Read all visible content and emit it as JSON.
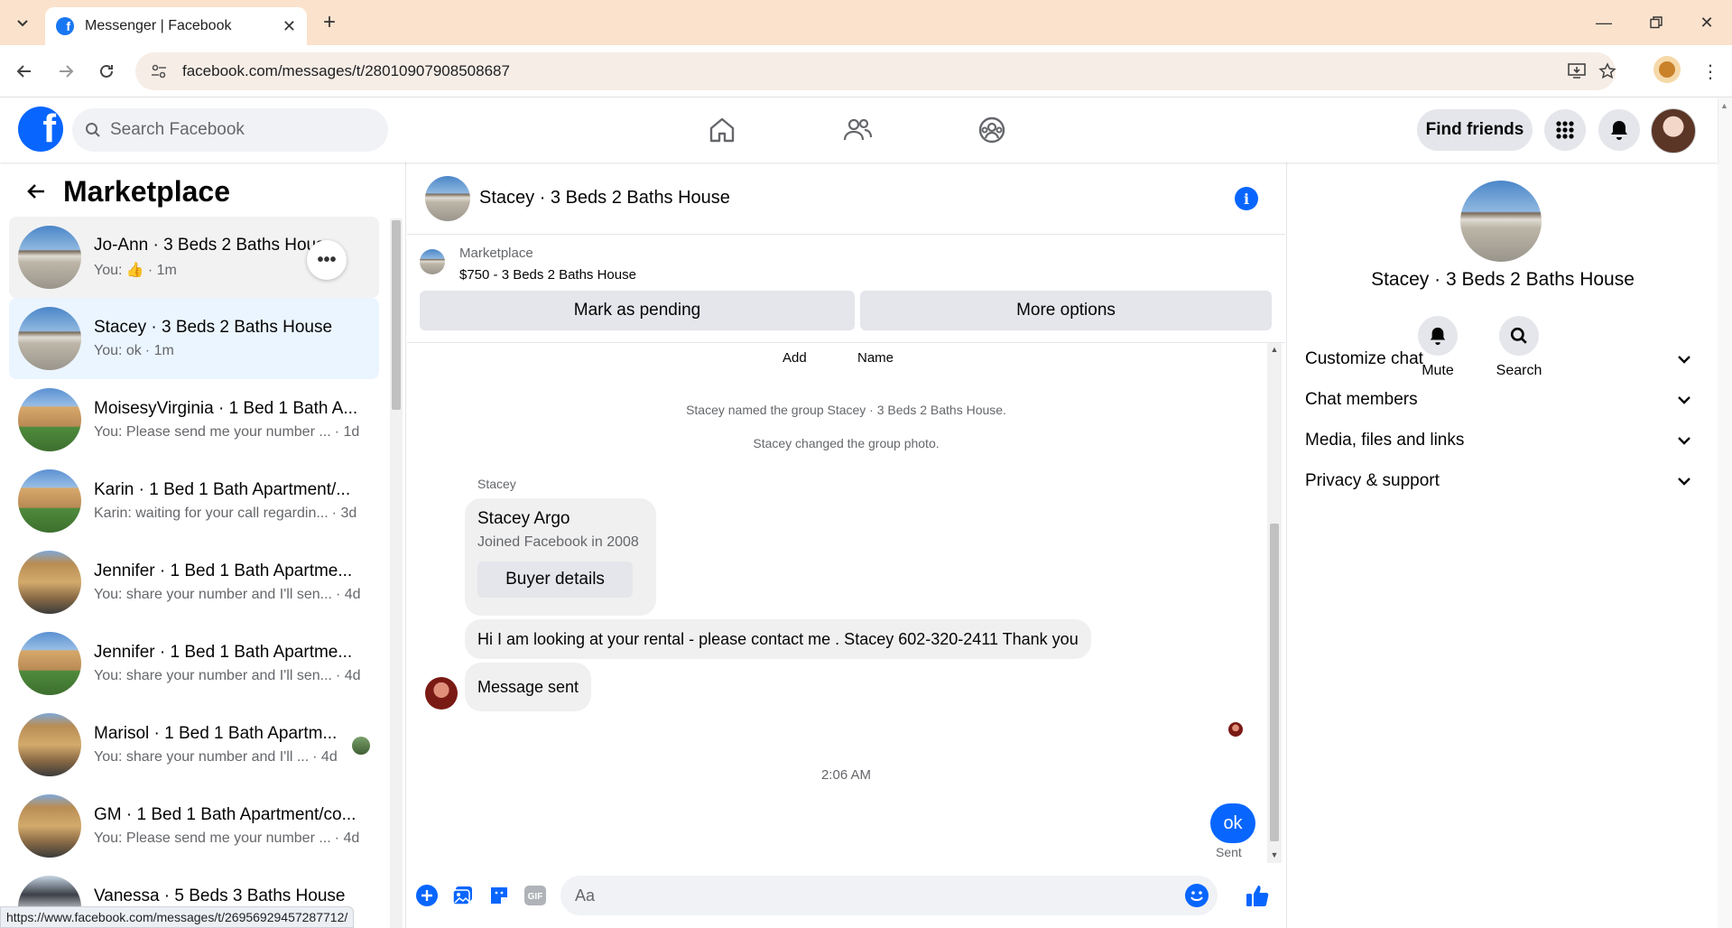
{
  "browser": {
    "tab_title": "Messenger | Facebook",
    "url": "facebook.com/messages/t/28010907908508687",
    "status_url": "https://www.facebook.com/messages/t/26956929457287712/"
  },
  "fb_header": {
    "search_placeholder": "Search Facebook",
    "find_friends_label": "Find friends"
  },
  "sidebar": {
    "title": "Marketplace",
    "conversations": [
      {
        "name": "Jo-Ann · 3 Beds 2 Baths House",
        "preview": "You: 👍",
        "time": "· 1m",
        "thumb": "house",
        "state": "hover"
      },
      {
        "name": "Stacey · 3 Beds 2 Baths House",
        "preview": "You: ok",
        "time": "· 1m",
        "thumb": "house",
        "state": "active"
      },
      {
        "name": "MoisesyVirginia · 1 Bed 1 Bath A...",
        "preview": "You: Please send me your number ...",
        "time": "· 1d",
        "thumb": "apt-green"
      },
      {
        "name": "Karin · 1 Bed 1 Bath Apartment/...",
        "preview": "Karin: waiting for your call regardin...",
        "time": "· 3d",
        "thumb": "apt-green"
      },
      {
        "name": "Jennifer · 1 Bed 1 Bath Apartme...",
        "preview": "You: share your number and I'll sen...",
        "time": "· 4d",
        "thumb": "apt-tan"
      },
      {
        "name": "Jennifer · 1 Bed 1 Bath Apartme...",
        "preview": "You: share your number and I'll sen...",
        "time": "· 4d",
        "thumb": "apt-green"
      },
      {
        "name": "Marisol · 1 Bed 1 Bath Apartm...",
        "preview": "You: share your number and I'll ...",
        "time": "· 4d",
        "thumb": "apt-tan"
      },
      {
        "name": "GM · 1 Bed 1 Bath Apartment/co...",
        "preview": "You: Please send me your number ...",
        "time": "· 4d",
        "thumb": "apt-tan"
      },
      {
        "name": "Vanessa · 5 Beds 3 Baths House",
        "preview": "",
        "time": "",
        "thumb": "apt-gray"
      }
    ]
  },
  "chat": {
    "title": "Stacey · 3 Beds 2 Baths House",
    "marketplace_label": "Marketplace",
    "listing": "$750 - 3 Beds 2 Baths House",
    "mark_pending_label": "Mark as pending",
    "more_options_label": "More options",
    "col_add": "Add",
    "col_name": "Name",
    "system_1": "Stacey named the group Stacey · 3 Beds 2 Baths House.",
    "system_2": "Stacey changed the group photo.",
    "sender": "Stacey",
    "card_name": "Stacey Argo",
    "card_sub": "Joined Facebook in 2008",
    "buyer_details_label": "Buyer details",
    "message_1": "Hi I am looking at your rental - please contact me . Stacey 602-320-2411  Thank you",
    "message_2": "Message sent",
    "time_separator": "2:06 AM",
    "my_message": "ok",
    "sent_label": "Sent",
    "composer_placeholder": "Aa"
  },
  "info_panel": {
    "name": "Stacey · 3 Beds 2 Baths House",
    "mute_label": "Mute",
    "search_label": "Search",
    "sections": [
      "Customize chat",
      "Chat members",
      "Media, files and links",
      "Privacy & support"
    ]
  },
  "colors": {
    "fb_blue": "#0866ff",
    "chrome_tab_bg": "#fbe2cc",
    "active_conv": "#ebf5ff"
  }
}
